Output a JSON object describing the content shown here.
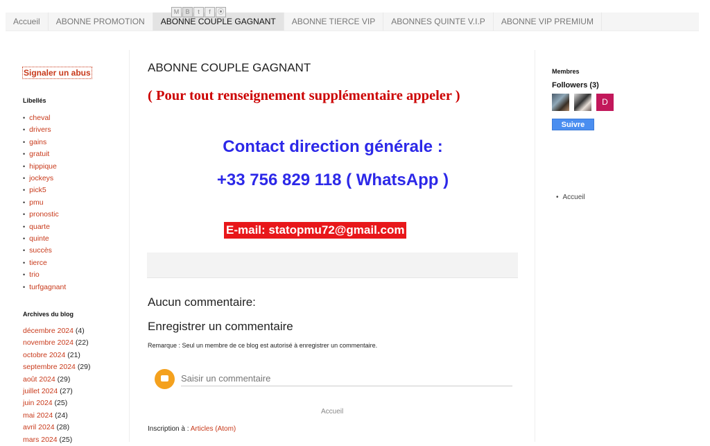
{
  "tabs": [
    "Accueil",
    "ABONNE PROMOTION",
    "ABONNE COUPLE GAGNANT",
    "ABONNE TIERCE VIP",
    "ABONNES QUINTE V.I.P",
    "ABONNE VIP PREMIUM"
  ],
  "sidebar": {
    "report_link": "Signaler un abus",
    "labels_heading": "Libellés",
    "labels": [
      "cheval",
      "drivers",
      "gains",
      "gratuit",
      "hippique",
      "jockeys",
      "pick5",
      "pmu",
      "pronostic",
      "quarte",
      "quinte",
      "succès",
      "tierce",
      "trio",
      "turfgagnant"
    ],
    "archives_heading": "Archives du blog",
    "archives": [
      {
        "month": "décembre 2024",
        "count": "(4)"
      },
      {
        "month": "novembre 2024",
        "count": "(22)"
      },
      {
        "month": "octobre 2024",
        "count": "(21)"
      },
      {
        "month": "septembre 2024",
        "count": "(29)"
      },
      {
        "month": "août 2024",
        "count": "(29)"
      },
      {
        "month": "juillet 2024",
        "count": "(27)"
      },
      {
        "month": "juin 2024",
        "count": "(25)"
      },
      {
        "month": "mai 2024",
        "count": "(24)"
      },
      {
        "month": "avril 2024",
        "count": "(28)"
      },
      {
        "month": "mars 2024",
        "count": "(25)"
      }
    ]
  },
  "post": {
    "title": "ABONNE COUPLE GAGNANT",
    "note": "( Pour tout renseignement  supplémentaire appeler  )",
    "contact_line": "Contact direction générale :",
    "phone_line": "+33 756 829 118 ( WhatsApp )",
    "email_line": "E-mail: statopmu72@gmail.com",
    "share_icons": [
      "email-icon",
      "blogger-icon",
      "twitter-icon",
      "facebook-icon",
      "pinterest-icon"
    ]
  },
  "comments": {
    "no_comments": "Aucun commentaire:",
    "heading": "Enregistrer un commentaire",
    "notice": "Remarque : Seul un membre de ce blog est autorisé à enregistrer un commentaire.",
    "input_placeholder": "Saisir un commentaire"
  },
  "footer": {
    "home_link": "Accueil",
    "subscribe_label": "Inscription à : ",
    "subscribe_link": "Articles (Atom)"
  },
  "right_sidebar": {
    "members_heading": "Membres",
    "followers_label": "Followers (3)",
    "avatar_letter": "D",
    "follow_button": "Suivre",
    "nav_link": "Accueil"
  }
}
